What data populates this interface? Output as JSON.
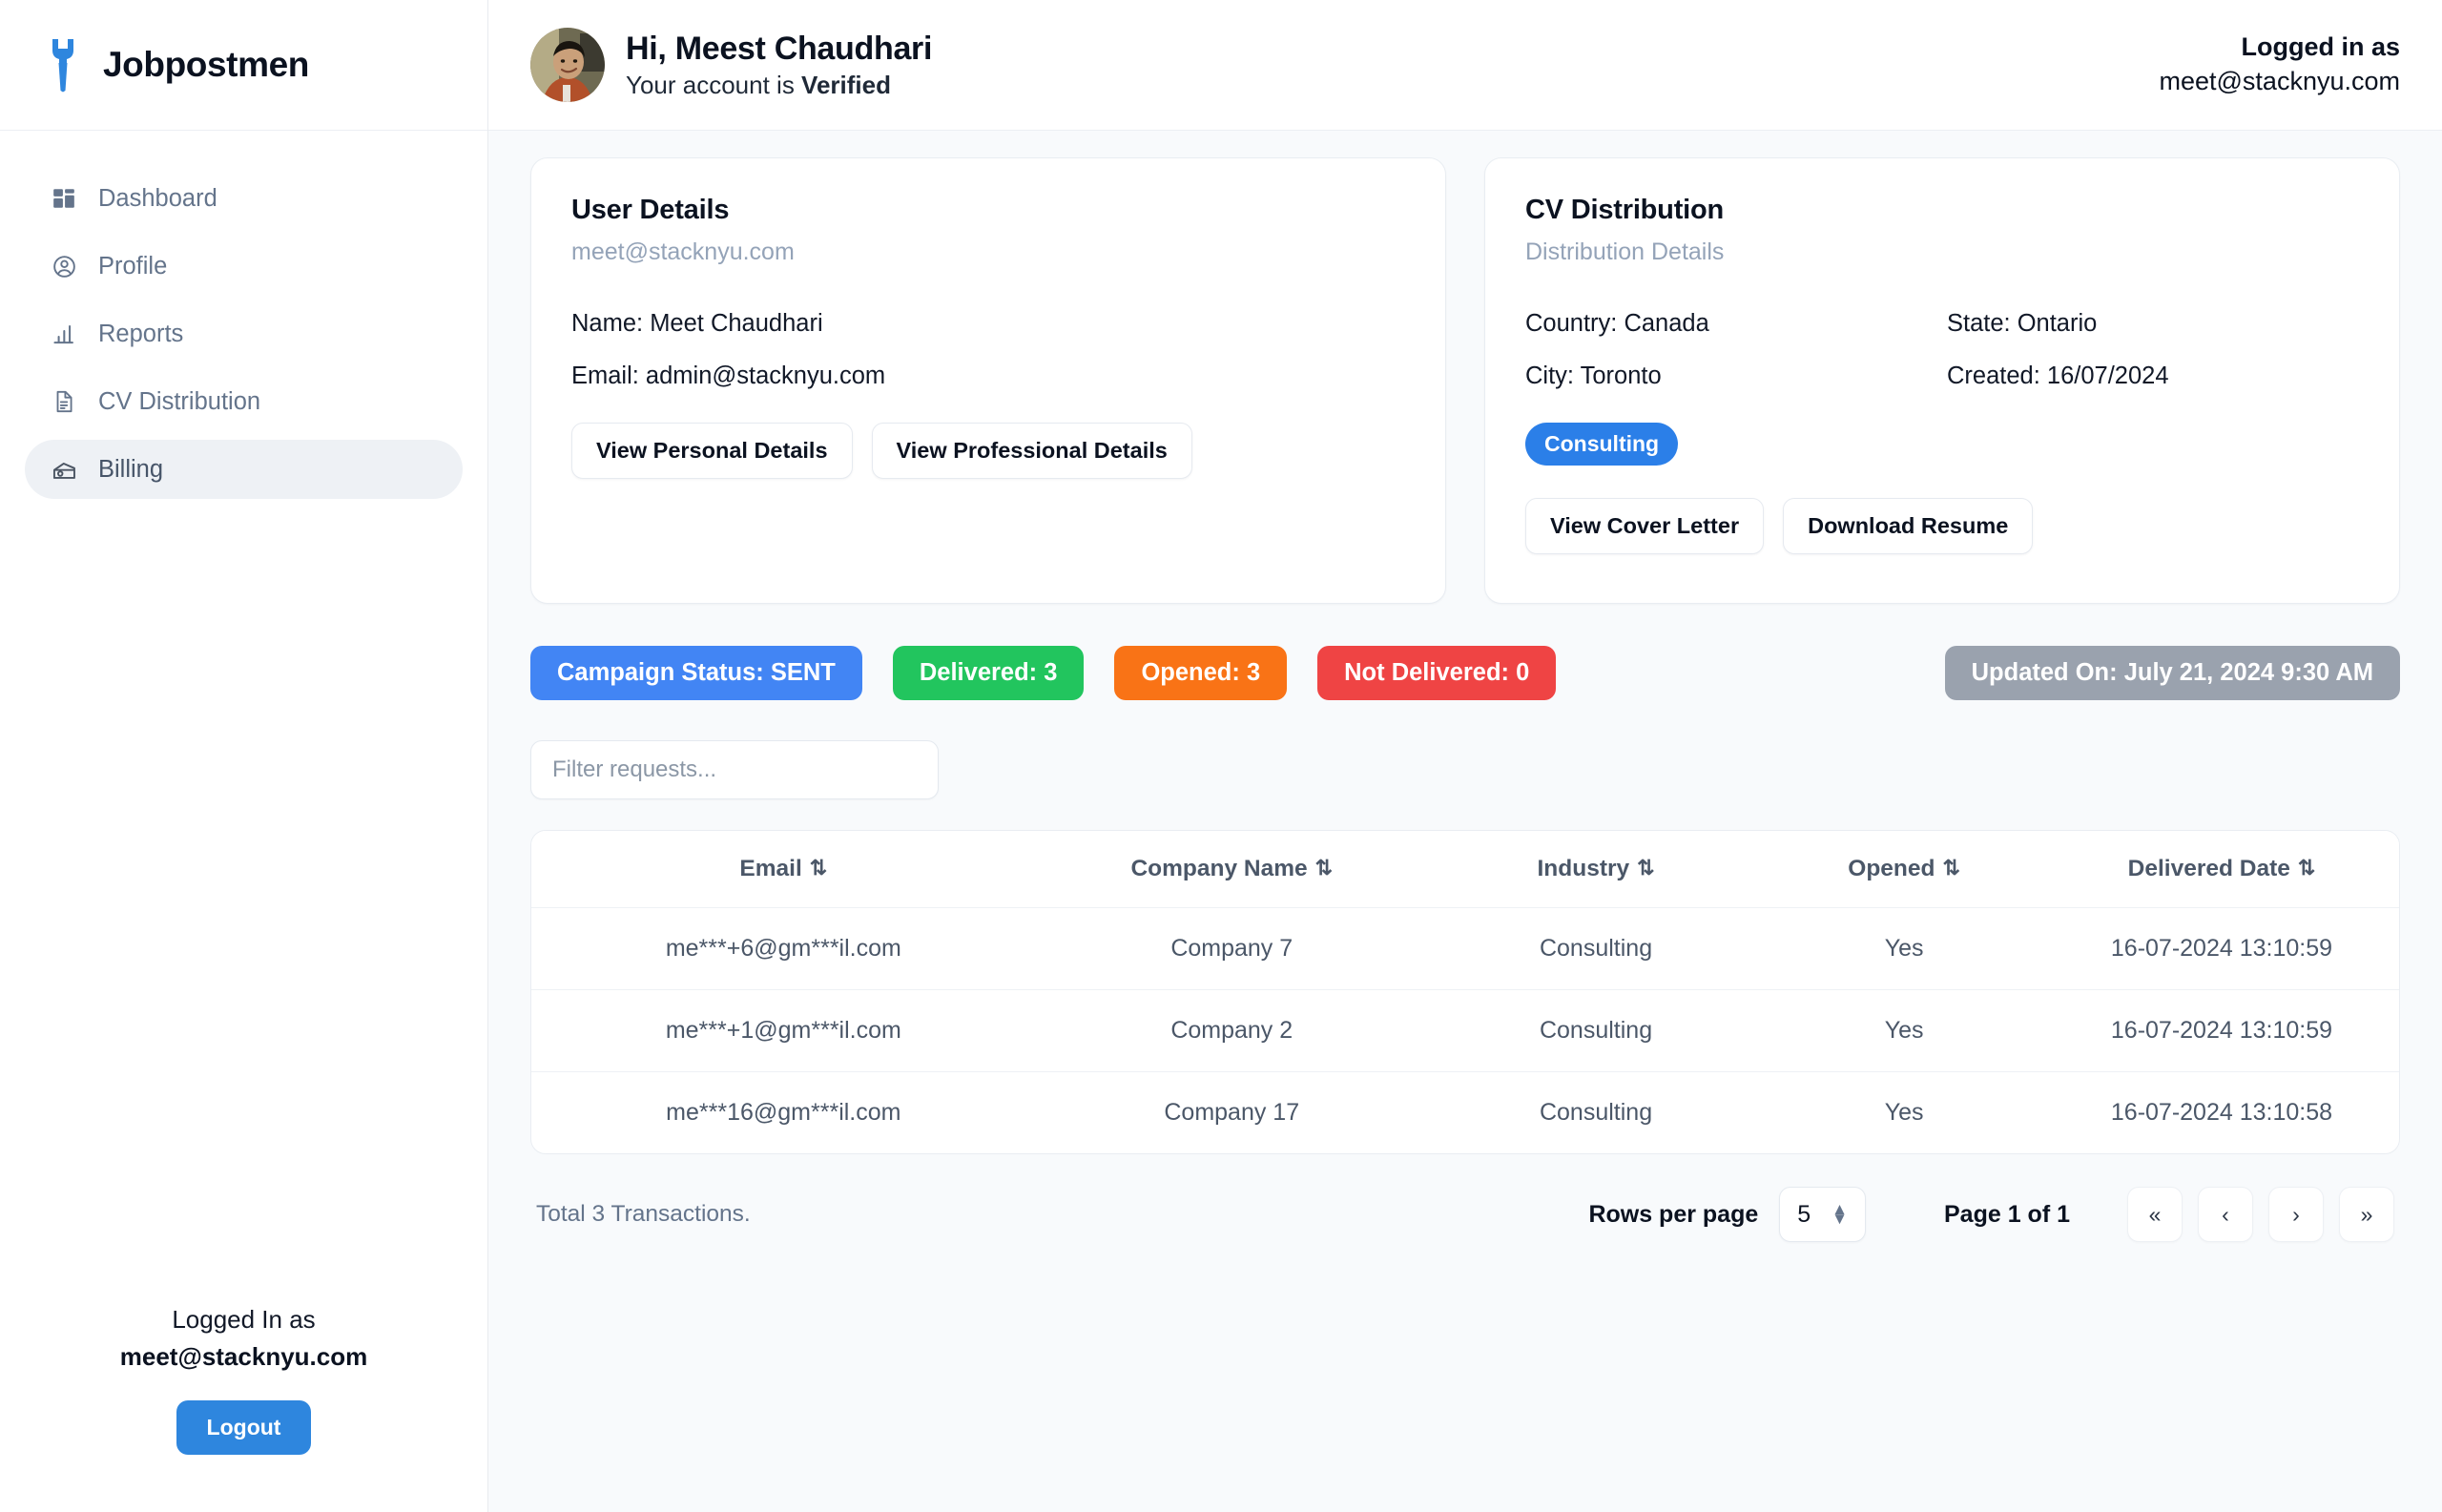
{
  "brand": {
    "name": "Jobpostmen",
    "logo_icon": "tie-wrench-icon",
    "logo_color": "#2e86de"
  },
  "sidebar": {
    "items": [
      {
        "label": "Dashboard",
        "icon": "dashboard-grid-icon",
        "active": false
      },
      {
        "label": "Profile",
        "icon": "user-circle-icon",
        "active": false
      },
      {
        "label": "Reports",
        "icon": "bar-chart-icon",
        "active": false
      },
      {
        "label": "CV Distribution",
        "icon": "document-icon",
        "active": false
      },
      {
        "label": "Billing",
        "icon": "money-envelope-icon",
        "active": true
      }
    ],
    "footer": {
      "logged_label": "Logged In as",
      "email": "meet@stacknyu.com",
      "logout_label": "Logout"
    }
  },
  "topbar": {
    "avatar_icon": "user-photo-avatar",
    "greeting": "Hi, Meest Chaudhari",
    "status_prefix": "Your account is ",
    "status_value": "Verified",
    "logged_in_label": "Logged in as",
    "logged_in_email": "meet@stacknyu.com"
  },
  "user_details": {
    "title": "User Details",
    "subtitle": "meet@stacknyu.com",
    "name_line": "Name: Meet Chaudhari",
    "email_line": "Email: admin@stacknyu.com",
    "btn_personal": "View Personal Details",
    "btn_professional": "View Professional Details"
  },
  "cv_distribution": {
    "title": "CV Distribution",
    "subtitle": "Distribution Details",
    "country": "Country: Canada",
    "state": "State: Ontario",
    "city": "City: Toronto",
    "created": "Created: 16/07/2024",
    "tag": "Consulting",
    "tag_color": "#2b7fe8",
    "btn_cover_letter": "View Cover Letter",
    "btn_download_resume": "Download Resume"
  },
  "badges": [
    {
      "label": "Campaign Status: SENT",
      "color": "#4285f4"
    },
    {
      "label": "Delivered: 3",
      "color": "#22c55e"
    },
    {
      "label": "Opened: 3",
      "color": "#f97316"
    },
    {
      "label": "Not Delivered: 0",
      "color": "#ef4444"
    }
  ],
  "updated_badge": {
    "label": "Updated On: July 21, 2024 9:30 AM",
    "color": "#9aa2ae"
  },
  "filter": {
    "placeholder": "Filter requests...",
    "value": ""
  },
  "table": {
    "columns": [
      {
        "label": "Email",
        "sort_icon": "sort-updown-icon"
      },
      {
        "label": "Company Name",
        "sort_icon": "sort-updown-icon"
      },
      {
        "label": "Industry",
        "sort_icon": "sort-updown-icon"
      },
      {
        "label": "Opened",
        "sort_icon": "sort-updown-icon"
      },
      {
        "label": "Delivered Date",
        "sort_icon": "sort-updown-icon"
      }
    ],
    "rows": [
      {
        "email": "me***+6@gm***il.com",
        "company": "Company 7",
        "industry": "Consulting",
        "opened": "Yes",
        "delivered_date": "16-07-2024 13:10:59"
      },
      {
        "email": "me***+1@gm***il.com",
        "company": "Company 2",
        "industry": "Consulting",
        "opened": "Yes",
        "delivered_date": "16-07-2024 13:10:59"
      },
      {
        "email": "me***16@gm***il.com",
        "company": "Company 17",
        "industry": "Consulting",
        "opened": "Yes",
        "delivered_date": "16-07-2024 13:10:58"
      }
    ]
  },
  "pagination": {
    "total_text": "Total 3 Transactions.",
    "rows_per_page_label": "Rows per page",
    "rows_per_page_value": "5",
    "page_text": "Page 1 of 1",
    "first_label": "«",
    "prev_label": "‹",
    "next_label": "›",
    "last_label": "»"
  }
}
